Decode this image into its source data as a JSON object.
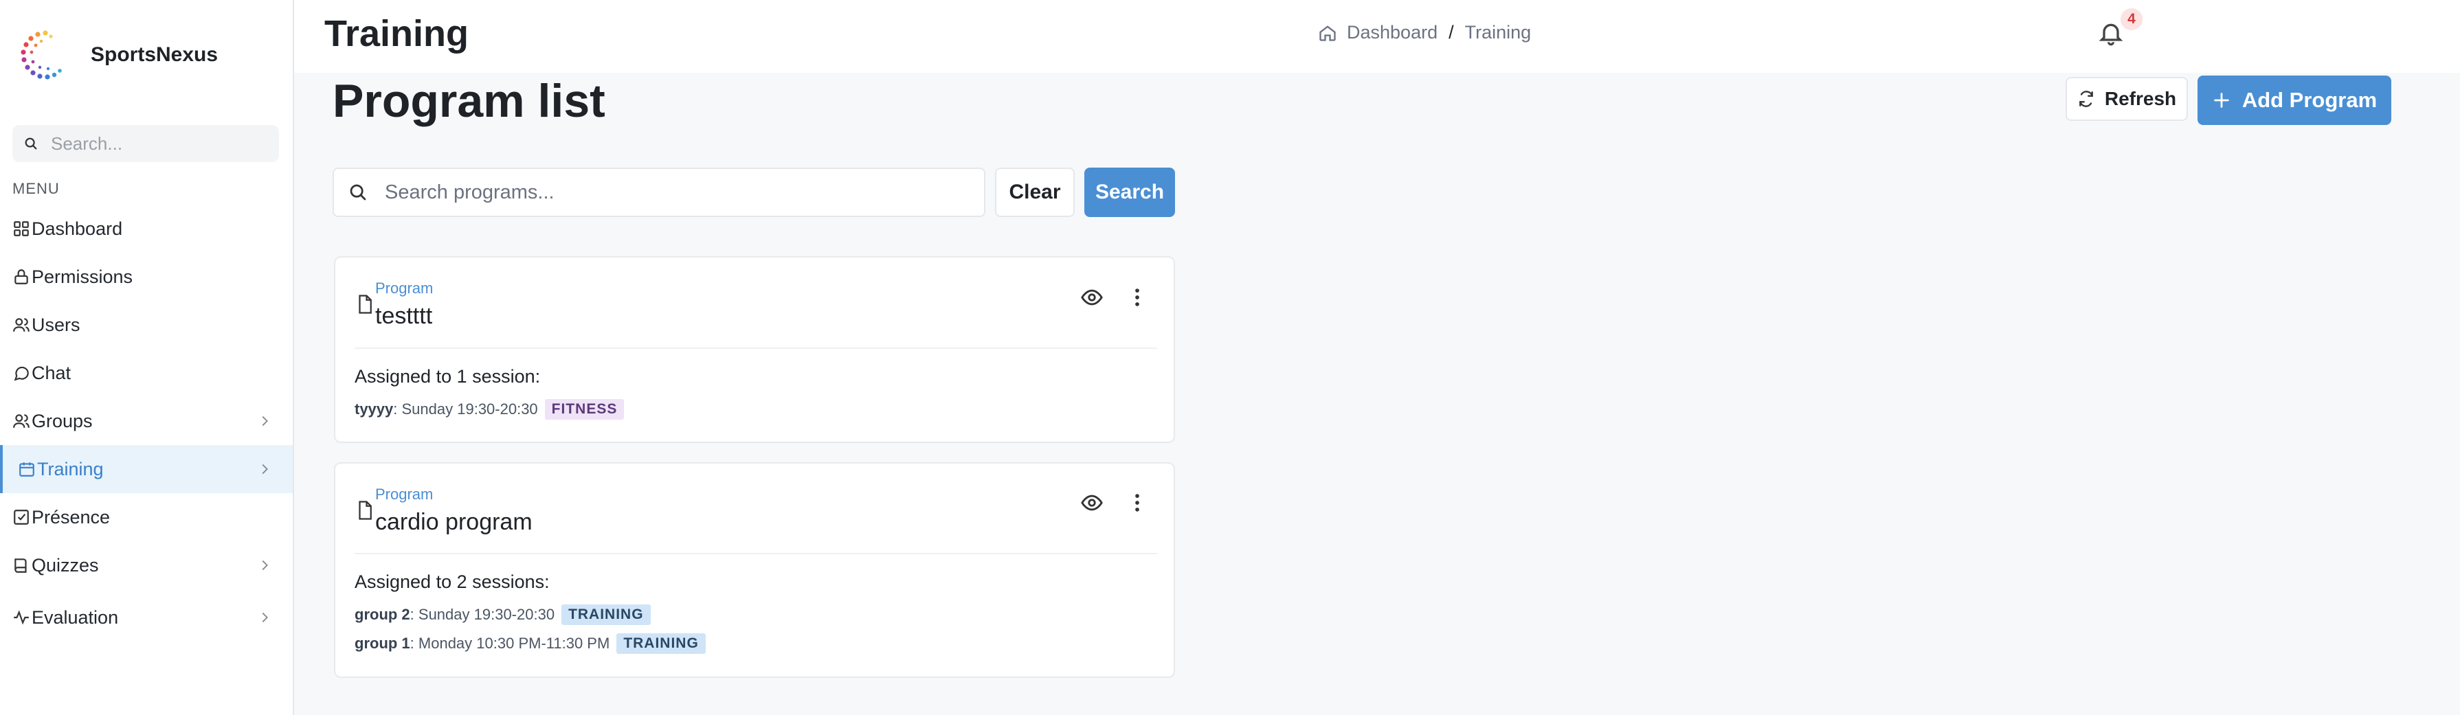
{
  "brand": {
    "name": "SportsNexus"
  },
  "sidebar": {
    "search_placeholder": "Search...",
    "menu_heading": "MENU",
    "items": [
      {
        "label": "Dashboard",
        "icon": "grid-icon"
      },
      {
        "label": "Permissions",
        "icon": "lock-icon"
      },
      {
        "label": "Users",
        "icon": "users-icon"
      },
      {
        "label": "Chat",
        "icon": "chat-icon"
      },
      {
        "label": "Groups",
        "icon": "users-icon"
      },
      {
        "label": "Training",
        "icon": "calendar-icon",
        "active": true
      },
      {
        "label": "Présence",
        "icon": "check-square-icon"
      },
      {
        "label": "Quizzes",
        "icon": "book-icon"
      },
      {
        "label": "Evaluation",
        "icon": "activity-icon"
      }
    ]
  },
  "header": {
    "title": "Training",
    "breadcrumb": {
      "home": "Dashboard",
      "separator": "/",
      "current": "Training"
    },
    "notifications_count": "4"
  },
  "main": {
    "page_title": "Program list",
    "refresh_label": "Refresh",
    "add_label": "Add Program",
    "search_placeholder": "Search programs...",
    "clear_label": "Clear",
    "search_label": "Search",
    "programs": [
      {
        "kind": "Program",
        "name": "testttt",
        "assigned": "Assigned to 1 session:",
        "sessions": [
          {
            "group": "tyyyy",
            "time": ": Sunday 19:30-20:30",
            "tag": "FITNESS"
          }
        ]
      },
      {
        "kind": "Program",
        "name": "cardio program",
        "assigned": "Assigned to 2 sessions:",
        "sessions": [
          {
            "group": "group 2",
            "time": ": Sunday 19:30-20:30",
            "tag": "TRAINING"
          },
          {
            "group": "group 1",
            "time": ": Monday 10:30 PM-11:30 PM",
            "tag": "TRAINING"
          }
        ]
      }
    ]
  },
  "colors": {
    "accent": "#4a8fd4",
    "active_bg": "#e8f3fc",
    "fitness_tag": "#efe3f7",
    "training_tag": "#cfe4f7"
  }
}
